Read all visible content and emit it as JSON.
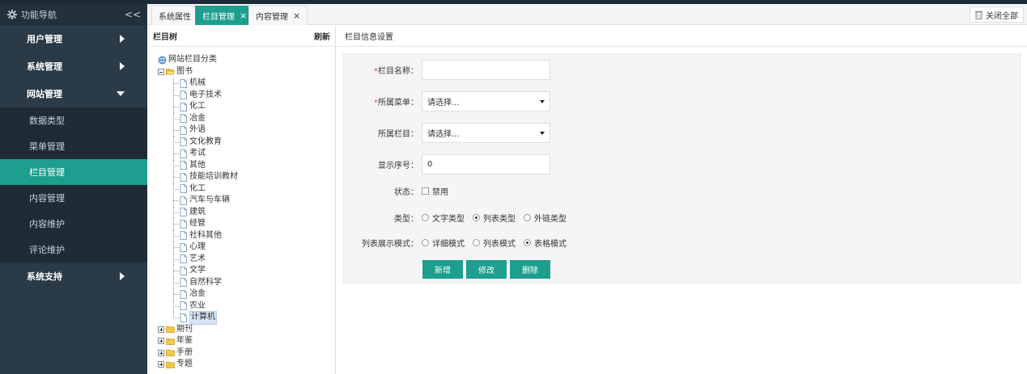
{
  "sidebar": {
    "title": "功能导航",
    "collapse_glyph": "<<",
    "groups": [
      {
        "label": "用户管理"
      },
      {
        "label": "系统管理"
      },
      {
        "label": "网站管理"
      },
      {
        "label": "系统支持"
      }
    ],
    "sub_items": [
      {
        "label": "数据类型"
      },
      {
        "label": "菜单管理"
      },
      {
        "label": "栏目管理"
      },
      {
        "label": "内容管理"
      },
      {
        "label": "内容维护"
      },
      {
        "label": "评论维护"
      }
    ],
    "accent_color": "#1d9e8e"
  },
  "tabs": {
    "items": [
      {
        "label": "系统属性"
      },
      {
        "label": "栏目管理"
      },
      {
        "label": "内容管理"
      }
    ],
    "close_all": "关闭全部",
    "close_glyph": "×"
  },
  "tree_panel": {
    "title": "栏目树",
    "refresh": "刷新",
    "root": "网站栏目分类",
    "open_folder": "图书",
    "leaves": [
      "机械",
      "电子技术",
      "化工",
      "冶金",
      "外语",
      "文化教育",
      "考试",
      "其他",
      "技能培训教材",
      "化工",
      "汽车与车辆",
      "建筑",
      "经管",
      "社科其他",
      "心理",
      "艺术",
      "文学",
      "自然科学",
      "冶金",
      "农业",
      "计算机"
    ],
    "selected_leaf": "计算机",
    "closed_folders": [
      "期刊",
      "年鉴",
      "手册",
      "专题"
    ]
  },
  "form": {
    "title": "栏目信息设置",
    "name_label": "栏目名称：",
    "name_value": "",
    "menu_label": "所属菜单：",
    "menu_value": "请选择...",
    "column_label": "所属栏目：",
    "column_value": "请选择...",
    "order_label": "显示序号：",
    "order_value": "0",
    "status_label": "状态：",
    "status_option": "禁用",
    "type_label": "类型：",
    "type_options": [
      "文字类型",
      "列表类型",
      "外链类型"
    ],
    "type_selected": "列表类型",
    "mode_label": "列表展示模式：",
    "mode_options": [
      "详细模式",
      "列表模式",
      "表格模式"
    ],
    "mode_selected": "表格模式",
    "buttons": {
      "add": "新增",
      "edit": "修改",
      "delete": "删除"
    }
  }
}
